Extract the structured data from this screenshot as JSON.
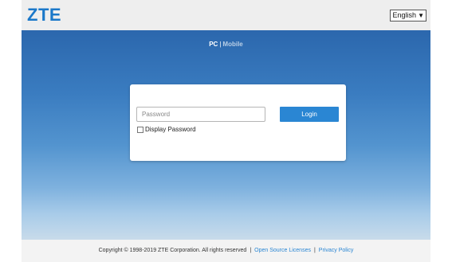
{
  "header": {
    "logo": "ZTE",
    "language": {
      "selected": "English"
    }
  },
  "view_switch": {
    "pc": "PC",
    "separator": "|",
    "mobile": "Mobile"
  },
  "login": {
    "password_placeholder": "Password",
    "password_value": "",
    "login_button": "Login",
    "show_password_label": "Display Password",
    "show_password_checked": false
  },
  "footer": {
    "copyright": "Copyright © 1998-2019 ZTE Corporation. All rights reserved",
    "separator": "|",
    "open_source": "Open Source Licenses",
    "privacy": "Privacy Policy"
  },
  "colors": {
    "brand": "#1b78c9",
    "button": "#2a86d3",
    "link": "#2a86d3"
  }
}
